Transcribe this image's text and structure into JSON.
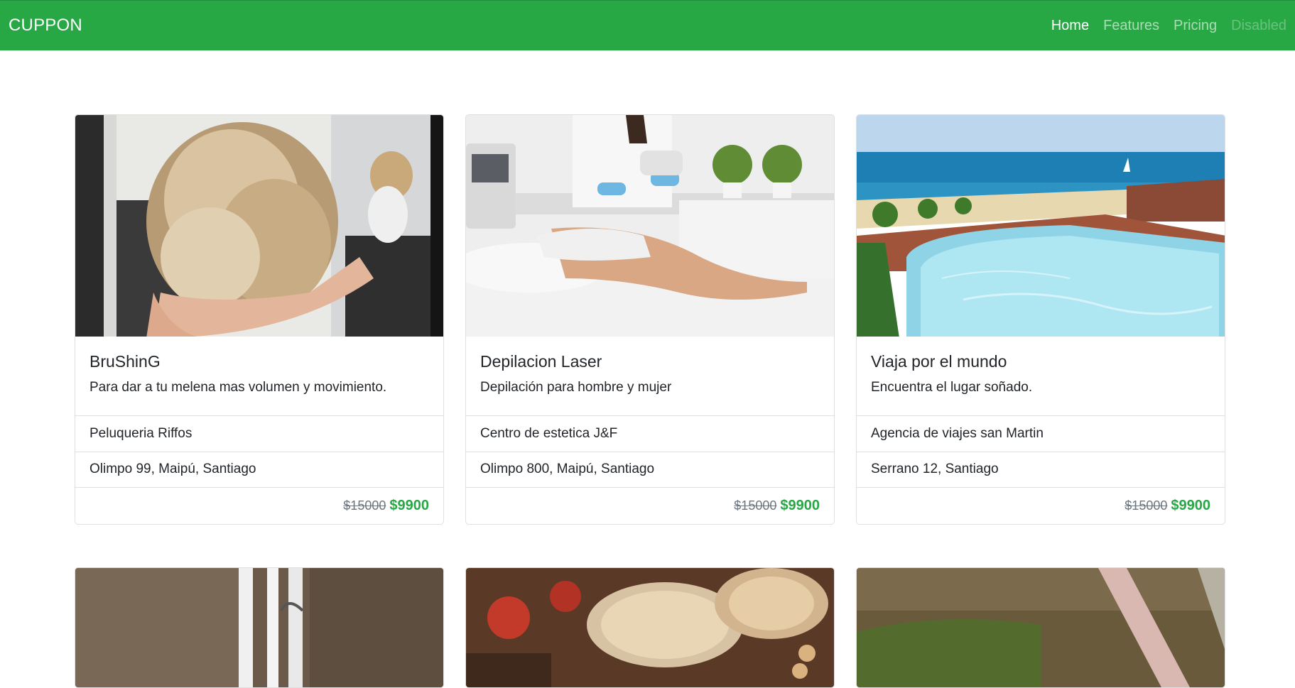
{
  "navbar": {
    "brand": "CUPPON",
    "links": [
      {
        "label": "Home",
        "state": "active"
      },
      {
        "label": "Features",
        "state": "link"
      },
      {
        "label": "Pricing",
        "state": "link"
      },
      {
        "label": "Disabled",
        "state": "disabled"
      }
    ]
  },
  "cards": [
    {
      "title": "BruShinG",
      "text": "Para dar a tu melena mas volumen y movimiento.",
      "business": "Peluqueria Riffos",
      "address": "Olimpo 99, Maipú, Santiago",
      "old_price": "$15000",
      "new_price": "$9900"
    },
    {
      "title": "Depilacion Laser",
      "text": "Depilación para hombre y mujer",
      "business": "Centro de estetica J&F",
      "address": "Olimpo 800, Maipú, Santiago",
      "old_price": "$15000",
      "new_price": "$9900"
    },
    {
      "title": "Viaja por el mundo",
      "text": "Encuentra el lugar soñado.",
      "business": "Agencia de viajes san Martin",
      "address": "Serrano 12, Santiago",
      "old_price": "$15000",
      "new_price": "$9900"
    }
  ],
  "colors": {
    "navbar_bg": "#28a745",
    "price_accent": "#28a745",
    "old_price": "#6c757d"
  }
}
